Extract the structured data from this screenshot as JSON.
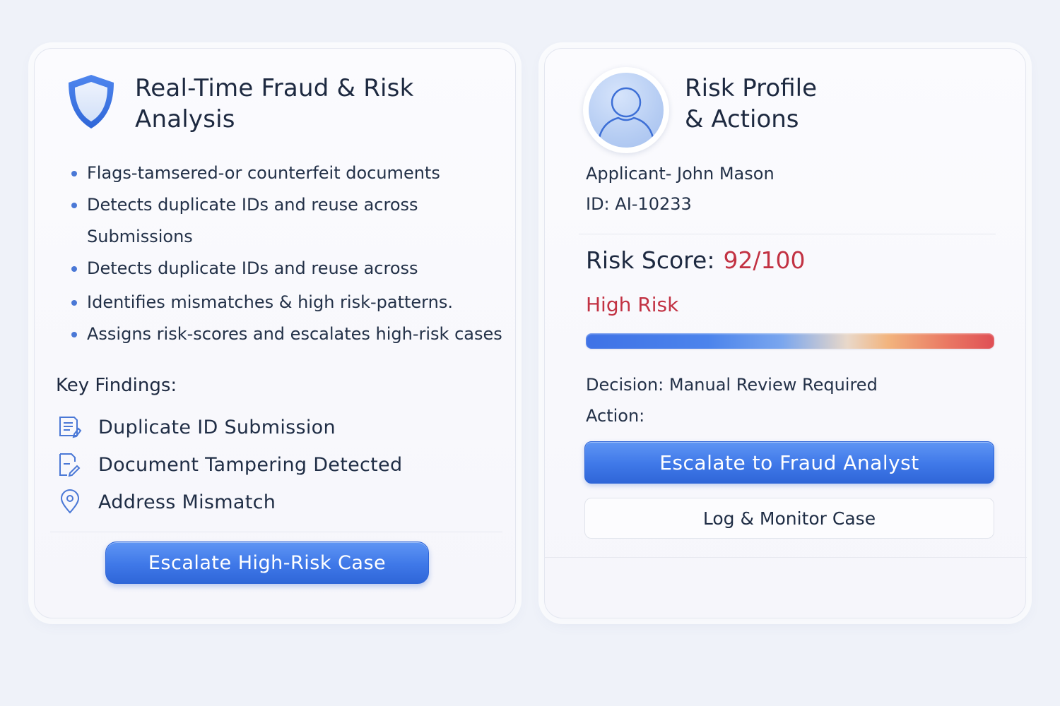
{
  "left_panel": {
    "title_line1": "Real-Time Fraud & Risk",
    "title_line2": "Analysis",
    "icon": "shield-icon",
    "bullets": [
      "Flags-tamsered-or counterfeit documents",
      "Detects duplicate IDs and reuse across",
      "Submissions",
      "Detects duplicate IDs and reuse across",
      "Identifies mismatches & high risk-patterns.",
      "Assigns risk-scores and escalates high-risk cases"
    ],
    "key_findings_title": "Key Findings:",
    "findings": [
      {
        "icon": "document-list-icon",
        "label": "Duplicate ID Submission"
      },
      {
        "icon": "document-edit-icon",
        "label": "Document Tampering Detected"
      },
      {
        "icon": "location-pin-icon",
        "label": "Address Mismatch"
      }
    ],
    "escalate_button": "Escalate High-Risk Case"
  },
  "right_panel": {
    "title_line1": "Risk Profile",
    "title_line2": "& Actions",
    "icon": "user-avatar-icon",
    "applicant_line": "Applicant- John Mason",
    "id_line": "ID: AI-10233",
    "risk_score_label": "Risk Score:",
    "risk_score_value": "92/100",
    "risk_score_fraction": 0.92,
    "risk_level": "High Risk",
    "decision_line": "Decision: Manual Review Required",
    "action_label": "Action:",
    "escalate_button": "Escalate to Fraud Analyst",
    "log_button": "Log & Monitor Case"
  },
  "colors": {
    "accent_blue": "#3f78e8",
    "risk_red": "#c23243",
    "background": "#eff2f9"
  }
}
